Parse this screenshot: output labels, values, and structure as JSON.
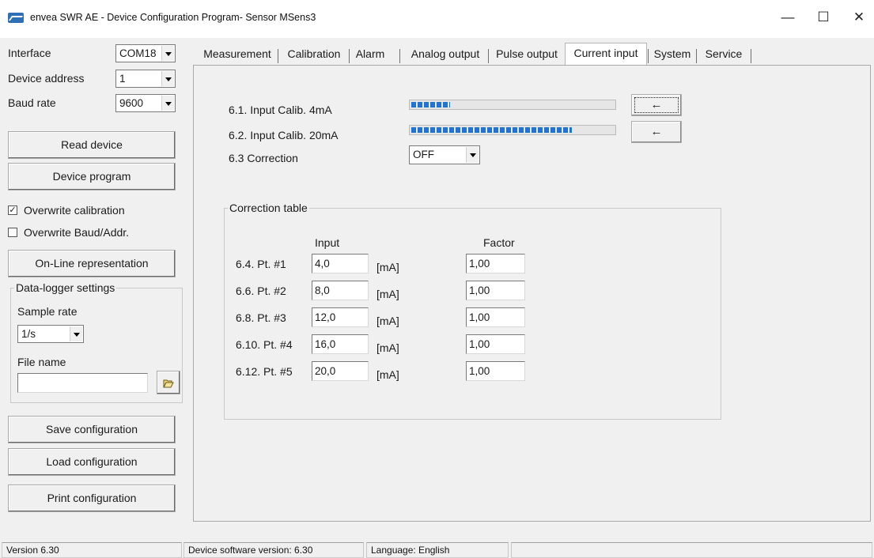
{
  "window": {
    "title": "envea SWR AE - Device Configuration Program- Sensor MSens3",
    "minimize": "—",
    "maximize": "☐",
    "close": "✕"
  },
  "sidebar": {
    "interface_label": "Interface",
    "interface_value": "COM18",
    "address_label": "Device address",
    "address_value": "1",
    "baud_label": "Baud rate",
    "baud_value": "9600",
    "read_device": "Read device",
    "device_program": "Device program",
    "overwrite_calibration": {
      "label": "Overwrite calibration",
      "checked": true,
      "mark": "✓"
    },
    "overwrite_baud": {
      "label": "Overwrite Baud/Addr.",
      "checked": false,
      "mark": ""
    },
    "online": "On-Line representation",
    "datalogger": {
      "title": "Data-logger settings",
      "sample_rate_label": "Sample rate",
      "sample_rate_value": "1/s",
      "file_name_label": "File name",
      "file_name_value": "",
      "folder_icon": "folder-open-icon"
    },
    "save_config": "Save configuration",
    "load_config": "Load configuration",
    "print_config": "Print configuration"
  },
  "tabs": [
    {
      "label": "Measurement",
      "active": false
    },
    {
      "label": "Calibration",
      "active": false
    },
    {
      "label": "Alarm",
      "active": false
    },
    {
      "label": "Analog output",
      "active": false
    },
    {
      "label": "Pulse output",
      "active": false
    },
    {
      "label": "Current input",
      "active": true
    },
    {
      "label": "System",
      "active": false
    },
    {
      "label": "Service",
      "active": false
    }
  ],
  "current_input": {
    "calib4": {
      "label": "6.1. Input Calib. 4mA",
      "progress": 0.19,
      "button": "←"
    },
    "calib20": {
      "label": "6.2. Input Calib. 20mA",
      "progress": 0.78,
      "button": "←"
    },
    "correction": {
      "label": "6.3 Correction",
      "value": "OFF"
    },
    "table": {
      "title": "Correction table",
      "input_header": "Input",
      "factor_header": "Factor",
      "unit": "[mA]",
      "rows": [
        {
          "label": "6.4. Pt. #1",
          "input": "4,0",
          "factor": "1,00"
        },
        {
          "label": "6.6. Pt. #2",
          "input": "8,0",
          "factor": "1,00"
        },
        {
          "label": "6.8. Pt. #3",
          "input": "12,0",
          "factor": "1,00"
        },
        {
          "label": "6.10. Pt. #4",
          "input": "16,0",
          "factor": "1,00"
        },
        {
          "label": "6.12. Pt. #5",
          "input": "20,0",
          "factor": "1,00"
        }
      ]
    }
  },
  "statusbar": {
    "version": "Version 6.30",
    "device_software": "Device software version: 6.30",
    "language": "Language: English",
    "extra": ""
  }
}
